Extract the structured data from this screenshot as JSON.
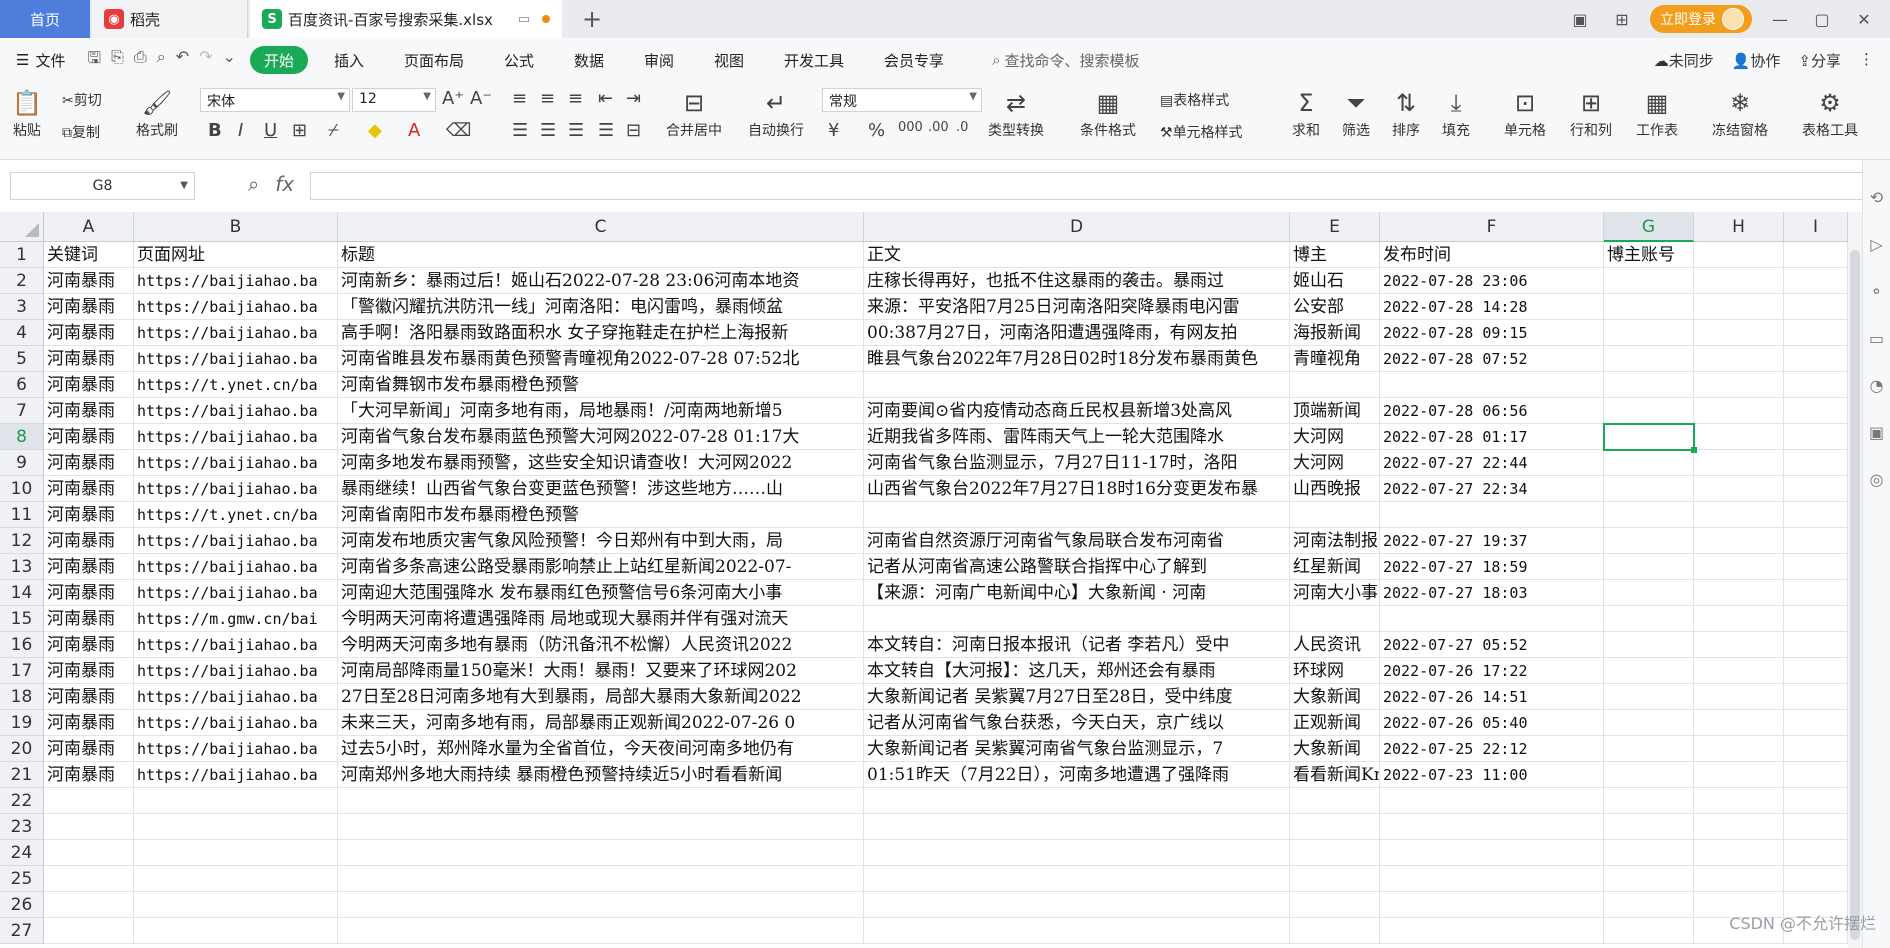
{
  "tabs": [
    {
      "label": "首页"
    },
    {
      "label": "稻壳",
      "icon": "daoke-logo-icon"
    },
    {
      "label": "百度资讯-百家号搜索采集.xlsx",
      "icon": "spreadsheet-s-icon"
    }
  ],
  "title_right": {
    "login_label": "立即登录"
  },
  "menu": {
    "file": "文件",
    "items": [
      "开始",
      "插入",
      "页面布局",
      "公式",
      "数据",
      "审阅",
      "视图",
      "开发工具",
      "会员专享"
    ],
    "active": "开始",
    "search_label": "查找命令、搜索模板",
    "sync": "未同步",
    "collab": "协作",
    "share": "分享"
  },
  "ribbon": {
    "paste": "粘贴",
    "cut": "剪切",
    "copy": "复制",
    "format_painter": "格式刷",
    "font_name": "宋体",
    "font_size": "12",
    "merge": "合并居中",
    "wrap": "自动换行",
    "number_format": "常规",
    "type_convert": "类型转换",
    "cond_format": "条件格式",
    "table_style": "表格样式",
    "cell_style": "单元格样式",
    "sum": "求和",
    "filter": "筛选",
    "sort": "排序",
    "fill": "填充",
    "cell": "单元格",
    "rowcol": "行和列",
    "sheet": "工作表",
    "freeze": "冻结窗格",
    "table_tools": "表格工具"
  },
  "formula_bar": {
    "name_box": "G8",
    "fx": "fx",
    "value": ""
  },
  "columns": [
    "A",
    "B",
    "C",
    "D",
    "E",
    "F",
    "G",
    "H",
    "I"
  ],
  "selected_column": "G",
  "selected_row": 8,
  "row_numbers": [
    "1",
    "2",
    "3",
    "4",
    "5",
    "6",
    "7",
    "8",
    "9",
    "10",
    "11",
    "12",
    "13",
    "14",
    "15",
    "16",
    "17",
    "18",
    "19",
    "20",
    "21",
    "22",
    "23",
    "24",
    "25",
    "26",
    "27"
  ],
  "rows": [
    [
      "关键词",
      "页面网址",
      "标题",
      "正文",
      "博主",
      "发布时间",
      "博主账号"
    ],
    [
      "河南暴雨",
      "https://baijiahao.ba",
      "河南新乡：暴雨过后！姬山石2022-07-28 23:06河南本地资",
      "庄稼长得再好，也抵不住这暴雨的袭击。暴雨过",
      "姬山石",
      "2022-07-28 23:06",
      ""
    ],
    [
      "河南暴雨",
      "https://baijiahao.ba",
      "「警徽闪耀抗洪防汛一线」河南洛阳：电闪雷鸣，暴雨倾盆",
      "来源：平安洛阳7月25日河南洛阳突降暴雨电闪雷",
      "公安部",
      "2022-07-28 14:28",
      ""
    ],
    [
      "河南暴雨",
      "https://baijiahao.ba",
      "高手啊！洛阳暴雨致路面积水 女子穿拖鞋走在护栏上海报新",
      "00:387月27日，河南洛阳遭遇强降雨，有网友拍",
      "海报新闻",
      "2022-07-28 09:15",
      ""
    ],
    [
      "河南暴雨",
      "https://baijiahao.ba",
      "河南省睢县发布暴雨黄色预警青曈视角2022-07-28 07:52北",
      "睢县气象台2022年7月28日02时18分发布暴雨黄色",
      "青曈视角",
      "2022-07-28 07:52",
      ""
    ],
    [
      "河南暴雨",
      "https://t.ynet.cn/ba",
      "河南省舞钢市发布暴雨橙色预警",
      "",
      "",
      "",
      ""
    ],
    [
      "河南暴雨",
      "https://baijiahao.ba",
      "「大河早新闻」河南多地有雨，局地暴雨！/河南两地新增5",
      "河南要闻⊙省内疫情动态商丘民权县新增3处高风",
      "顶端新闻",
      "2022-07-28 06:56",
      ""
    ],
    [
      "河南暴雨",
      "https://baijiahao.ba",
      "河南省气象台发布暴雨蓝色预警大河网2022-07-28 01:17大",
      "近期我省多阵雨、雷阵雨天气上一轮大范围降水",
      "大河网",
      "2022-07-28 01:17",
      ""
    ],
    [
      "河南暴雨",
      "https://baijiahao.ba",
      "河南多地发布暴雨预警，这些安全知识请查收！大河网2022",
      "河南省气象台监测显示，7月27日11-17时，洛阳",
      "大河网",
      "2022-07-27 22:44",
      ""
    ],
    [
      "河南暴雨",
      "https://baijiahao.ba",
      "暴雨继续！山西省气象台变更蓝色预警！涉这些地方……山",
      "山西省气象台2022年7月27日18时16分变更发布暴",
      "山西晚报",
      "2022-07-27 22:34",
      ""
    ],
    [
      "河南暴雨",
      "https://t.ynet.cn/ba",
      "河南省南阳市发布暴雨橙色预警",
      "",
      "",
      "",
      ""
    ],
    [
      "河南暴雨",
      "https://baijiahao.ba",
      "河南发布地质灾害气象风险预警！今日郑州有中到大雨，局",
      "河南省自然资源厅河南省气象局联合发布河南省",
      "河南法制报",
      "2022-07-27 19:37",
      ""
    ],
    [
      "河南暴雨",
      "https://baijiahao.ba",
      "河南省多条高速公路受暴雨影响禁止上站红星新闻2022-07-",
      "记者从河南省高速公路警联合指挥中心了解到",
      "红星新闻",
      "2022-07-27 18:59",
      ""
    ],
    [
      "河南暴雨",
      "https://baijiahao.ba",
      "河南迎大范围强降水 发布暴雨红色预警信号6条河南大小事",
      "【来源：河南广电新闻中心】大象新闻 · 河南",
      "河南大小事",
      "2022-07-27 18:03",
      ""
    ],
    [
      "河南暴雨",
      "https://m.gmw.cn/bai",
      "今明两天河南将遭遇强降雨 局地或现大暴雨并伴有强对流天",
      "",
      "",
      "",
      ""
    ],
    [
      "河南暴雨",
      "https://baijiahao.ba",
      "今明两天河南多地有暴雨（防汛备汛不松懈）人民资讯2022",
      "本文转自：河南日报本报讯（记者 李若凡）受中",
      "人民资讯",
      "2022-07-27 05:52",
      ""
    ],
    [
      "河南暴雨",
      "https://baijiahao.ba",
      "河南局部降雨量150毫米！大雨！暴雨！又要来了环球网202",
      "本文转自【大河报】：这几天，郑州还会有暴雨",
      "环球网",
      "2022-07-26 17:22",
      ""
    ],
    [
      "河南暴雨",
      "https://baijiahao.ba",
      "27日至28日河南多地有大到暴雨，局部大暴雨大象新闻2022",
      "大象新闻记者 吴紫翼7月27日至28日，受中纬度",
      "大象新闻",
      "2022-07-26 14:51",
      ""
    ],
    [
      "河南暴雨",
      "https://baijiahao.ba",
      "未来三天，河南多地有雨，局部暴雨正观新闻2022-07-26 0",
      "记者从河南省气象台获悉，今天白天，京广线以",
      "正观新闻",
      "2022-07-26 05:40",
      ""
    ],
    [
      "河南暴雨",
      "https://baijiahao.ba",
      "过去5小时，郑州降水量为全省首位，今天夜间河南多地仍有",
      "大象新闻记者 吴紫翼河南省气象台监测显示，7",
      "大象新闻",
      "2022-07-25 22:12",
      ""
    ],
    [
      "河南暴雨",
      "https://baijiahao.ba",
      "河南郑州多地大雨持续 暴雨橙色预警持续近5小时看看新闻",
      "01:51昨天（7月22日），河南多地遭遇了强降雨",
      "看看新闻Kn",
      "2022-07-23 11:00",
      ""
    ]
  ],
  "watermark": "CSDN @不允许摆烂"
}
